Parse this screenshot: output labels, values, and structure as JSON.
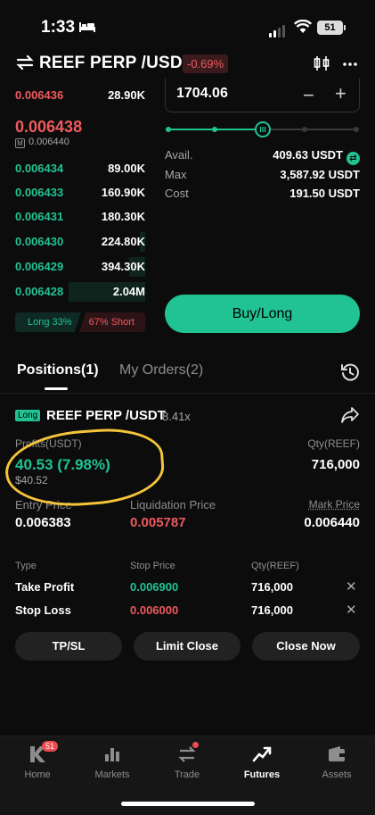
{
  "status": {
    "time": "1:33",
    "battery": "51"
  },
  "header": {
    "pair": "REEF PERP /USDT",
    "change": "-0.69%"
  },
  "orderbook": {
    "asks": [
      {
        "price": "0.006436",
        "qty": "28.90K"
      }
    ],
    "mid_price": "0.006438",
    "mark_price": "0.006440",
    "mark_label": "M",
    "bids": [
      {
        "price": "0.006434",
        "qty": "89.00K"
      },
      {
        "price": "0.006433",
        "qty": "160.90K"
      },
      {
        "price": "0.006431",
        "qty": "180.30K"
      },
      {
        "price": "0.006430",
        "qty": "224.80K"
      },
      {
        "price": "0.006429",
        "qty": "394.30K"
      },
      {
        "price": "0.006428",
        "qty": "2.04M"
      }
    ],
    "long_ratio": "Long 33%",
    "short_ratio": "67% Short"
  },
  "order_form": {
    "quantity": "1704.06",
    "slider_level": 0.5,
    "avail_label": "Avail.",
    "avail_value": "409.63 USDT",
    "max_label": "Max",
    "max_value": "3,587.92 USDT",
    "cost_label": "Cost",
    "cost_value": "191.50 USDT",
    "buy_label": "Buy/Long"
  },
  "tabs": {
    "positions": "Positions(1)",
    "orders": "My Orders(2)"
  },
  "position": {
    "side": "Long",
    "pair": "REEF PERP /USDT",
    "leverage": "8.41x",
    "profits_label": "Profits(USDT)",
    "profits_value": "40.53 (7.98%)",
    "profits_usd": "$40.52",
    "qty_label": "Qty(REEF)",
    "qty_value": "716,000",
    "entry_label": "Entry Price",
    "entry_value": "0.006383",
    "liq_label": "Liquidation Price",
    "liq_value": "0.005787",
    "mark_label": "Mark Price",
    "mark_value": "0.006440"
  },
  "stop_orders": {
    "headers": [
      "Type",
      "Stop Price",
      "Qty(REEF)"
    ],
    "rows": [
      {
        "type": "Take Profit",
        "price": "0.006900",
        "qty": "716,000"
      },
      {
        "type": "Stop Loss",
        "price": "0.006000",
        "qty": "716,000"
      }
    ]
  },
  "actions": {
    "tpsl": "TP/SL",
    "limit_close": "Limit Close",
    "close_now": "Close Now"
  },
  "nav": {
    "home": "Home",
    "markets": "Markets",
    "trade": "Trade",
    "futures": "Futures",
    "assets": "Assets",
    "home_badge": "51"
  },
  "colors": {
    "green": "#21c393",
    "red": "#ef5a5e",
    "highlight": "#f4c43a"
  }
}
